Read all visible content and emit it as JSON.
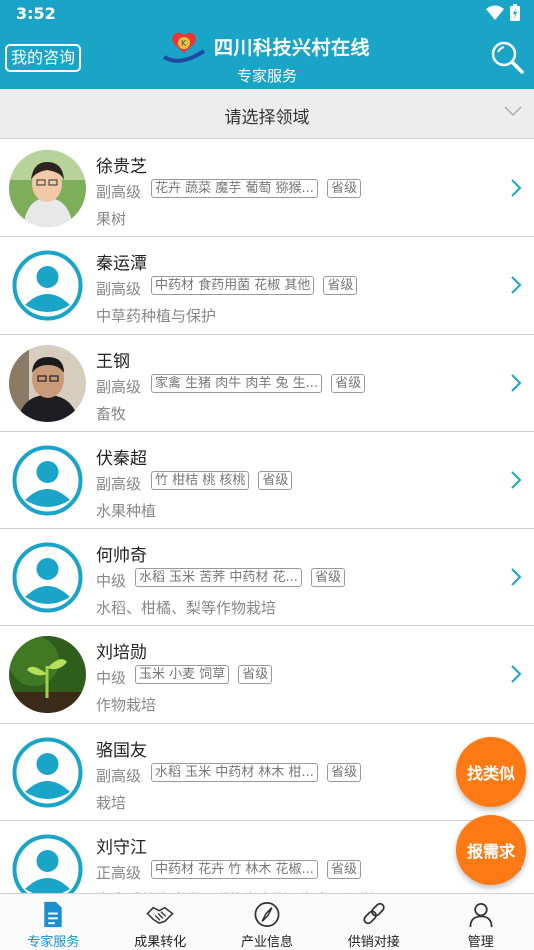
{
  "status_bar": {
    "time": "3:52"
  },
  "app_bar": {
    "left_button": "我的咨询",
    "title": "四川科技兴村在线",
    "subtitle": "专家服务"
  },
  "filter": {
    "label": "请选择领域"
  },
  "experts": [
    {
      "name": "徐贵芝",
      "level": "副高级",
      "tags": [
        "花卉 蔬菜 魔芋 葡萄 猕猴...",
        "省级"
      ],
      "field": "果树",
      "avatar": "photo-woman"
    },
    {
      "name": "秦运潭",
      "level": "副高级",
      "tags": [
        "中药材 食药用菌 花椒 其他",
        "省级"
      ],
      "field": "中草药种植与保护",
      "avatar": "default"
    },
    {
      "name": "王钢",
      "level": "副高级",
      "tags": [
        "家禽 生猪 肉牛 肉羊 兔 生...",
        "省级"
      ],
      "field": "畜牧",
      "avatar": "photo-man"
    },
    {
      "name": "伏秦超",
      "level": "副高级",
      "tags": [
        "竹 柑桔 桃 核桃",
        "省级"
      ],
      "field": "水果种植",
      "avatar": "default"
    },
    {
      "name": "何帅奇",
      "level": "中级",
      "tags": [
        "水稻 玉米 苦荞 中药材 花...",
        "省级"
      ],
      "field": "水稻、柑橘、梨等作物栽培",
      "avatar": "default"
    },
    {
      "name": "刘培勋",
      "level": "中级",
      "tags": [
        "玉米 小麦 饲草",
        "省级"
      ],
      "field": "作物栽培",
      "avatar": "photo-sprout"
    },
    {
      "name": "骆国友",
      "level": "副高级",
      "tags": [
        "水稻 玉米 中药材 林木 柑...",
        "省级"
      ],
      "field": "栽培",
      "avatar": "default"
    },
    {
      "name": "刘守江",
      "level": "正高级",
      "tags": [
        "中药材 花卉 竹 林木 花椒...",
        "省级"
      ],
      "field": "生态系统生态学&群落生态学&生态工程学",
      "avatar": "default"
    }
  ],
  "fabs": {
    "similar": "找类似",
    "demand": "报需求"
  },
  "bottom_nav": [
    {
      "label": "专家服务",
      "icon": "document-icon",
      "active": true
    },
    {
      "label": "成果转化",
      "icon": "handshake-icon",
      "active": false
    },
    {
      "label": "产业信息",
      "icon": "compass-icon",
      "active": false
    },
    {
      "label": "供销对接",
      "icon": "link-icon",
      "active": false
    },
    {
      "label": "管理",
      "icon": "person-icon",
      "active": false
    }
  ],
  "colors": {
    "primary": "#1aa5c8",
    "fab": "#ff7a14",
    "nav_active": "#1a8fd0"
  }
}
